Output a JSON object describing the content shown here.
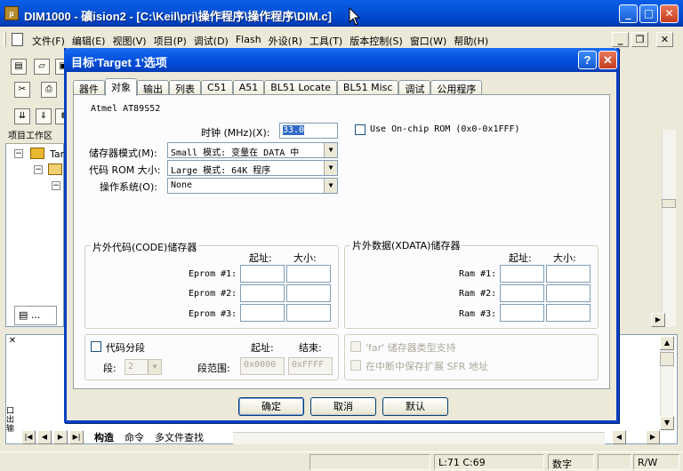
{
  "window": {
    "title": "DIM1000  - 礦ision2 - [C:\\Keil\\prj\\操作程序\\操作程序\\DIM.c]",
    "app_icon_label": "µ"
  },
  "menu": {
    "items": [
      "文件(F)",
      "编辑(E)",
      "视图(V)",
      "项目(P)",
      "调试(D)",
      "Flash",
      "外设(R)",
      "工具(T)",
      "版本控制(S)",
      "窗口(W)",
      "帮助(H)"
    ]
  },
  "project_panel": {
    "title": "项目工作区",
    "tree": [
      "Tar"
    ]
  },
  "output": {
    "side_label": "口\n出\n输",
    "tabs": [
      "构造",
      "命令",
      "多文件查找"
    ]
  },
  "status": {
    "position": "L:71 C:69",
    "numlock": "数字",
    "mode": "R/W"
  },
  "dialog": {
    "title": "目标'Target 1'选项",
    "tabs": [
      "器件",
      "对象",
      "输出",
      "列表",
      "C51",
      "A51",
      "BL51 Locate",
      "BL51 Misc",
      "调试",
      "公用程序"
    ],
    "active_tab": "对象",
    "device": "Atmel AT89S52",
    "clock_label": "时钟 (MHz)(X):",
    "clock_value": "33.0",
    "use_onchip_rom": "Use On-chip ROM (0x0-0x1FFF)",
    "memory_model_label": "储存器模式(M):",
    "memory_model_value": "Small 模式: 变量在 DATA 中",
    "code_rom_label": "代码 ROM 大小:",
    "code_rom_value": "Large 模式: 64K 程序",
    "os_label": "操作系统(O):",
    "os_value": "None",
    "code_group": {
      "title": "片外代码(CODE)储存器",
      "start_header": "起址:",
      "size_header": "大小:",
      "rows": [
        {
          "label": "Eprom #1:",
          "start": "",
          "size": ""
        },
        {
          "label": "Eprom #2:",
          "start": "",
          "size": ""
        },
        {
          "label": "Eprom #3:",
          "start": "",
          "size": ""
        }
      ]
    },
    "xdata_group": {
      "title": "片外数据(XDATA)储存器",
      "start_header": "起址:",
      "size_header": "大小:",
      "rows": [
        {
          "label": "Ram #1:",
          "start": "",
          "size": ""
        },
        {
          "label": "Ram #2:",
          "start": "",
          "size": ""
        },
        {
          "label": "Ram #3:",
          "start": "",
          "size": ""
        }
      ]
    },
    "code_banking": {
      "label": "代码分段",
      "start_header": "起址:",
      "end_header": "结束:",
      "bank_label": "段:",
      "bank_value": "2",
      "range_label": "段范围:",
      "range_start": "0x0000",
      "range_end": "0xFFFF"
    },
    "far_support": "'far' 储存器类型支持",
    "save_sfr": "在中断中保存扩展 SFR 地址",
    "buttons": {
      "ok": "确定",
      "cancel": "取消",
      "default": "默认"
    }
  }
}
